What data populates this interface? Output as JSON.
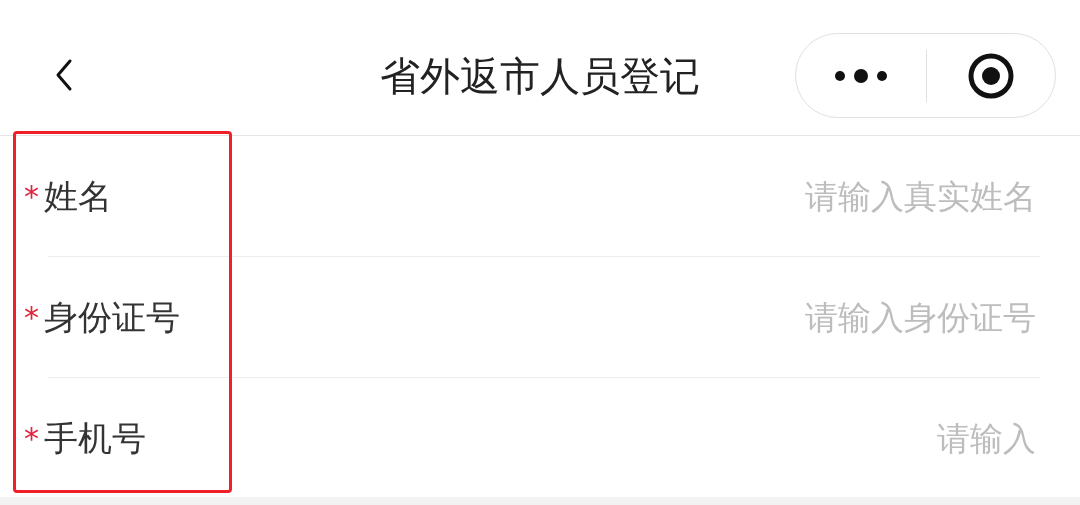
{
  "nav_bar": {
    "title": "省外返市人员登记"
  },
  "fields": [
    {
      "required_mark": "*",
      "label": "姓名",
      "placeholder": "请输入真实姓名"
    },
    {
      "required_mark": "*",
      "label": "身份证号",
      "placeholder": "请输入身份证号"
    },
    {
      "required_mark": "*",
      "label": "手机号",
      "placeholder": "请输入"
    }
  ]
}
